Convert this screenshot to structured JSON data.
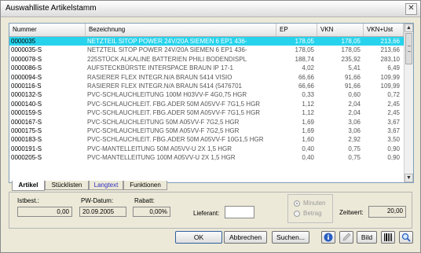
{
  "window": {
    "title": "Auswahlliste Artikelstamm"
  },
  "columns": [
    "Nummer",
    "Bezeichnung",
    "EP",
    "VKN",
    "VKN+Ust"
  ],
  "rows": [
    {
      "nr": "0000035",
      "bez": "NETZTEIL SITOP POWER 24V/20A     SIEMEN 6 EP1 436-",
      "ep": "178,05",
      "vkn": "178,05",
      "vku": "213,66",
      "selected": true
    },
    {
      "nr": "0000035-S",
      "bez": "NETZTEIL SITOP POWER 24V/20A     SIEMEN 6 EP1 436-",
      "ep": "178,05",
      "vkn": "178,05",
      "vku": "213,66"
    },
    {
      "nr": "0000078-S",
      "bez": "225STÜCK ALKALINE BATTERIEN      PHILI BODENDISPL",
      "ep": "188,74",
      "vkn": "235,92",
      "vku": "283,10"
    },
    {
      "nr": "0000086-S",
      "bez": "AUFSTECKBÜRSTE INTERSPACE        BRAUN IP   17-1",
      "ep": "4,02",
      "vkn": "5,41",
      "vku": "6,49"
    },
    {
      "nr": "0000094-S",
      "bez": "RASIERER FLEX INTEGR.N/A           BRAUN 5414    VISIO",
      "ep": "66,66",
      "vkn": "91,66",
      "vku": "109,99"
    },
    {
      "nr": "0000116-S",
      "bez": "RASIERER FLEX INTEGR.N/A           BRAUN 5414 (5476701",
      "ep": "66,66",
      "vkn": "91,66",
      "vku": "109,99"
    },
    {
      "nr": "0000132-S",
      "bez": "PVC-SCHLAUCHLEITUNG          100M H03VV-F 4G0,75 HGR",
      "ep": "0,33",
      "vkn": "0,60",
      "vku": "0,72"
    },
    {
      "nr": "0000140-S",
      "bez": "PVC-SCHLAUCHLEIT. FBG.ADER 50M A05VV-F 7G1,5  HGR",
      "ep": "1,12",
      "vkn": "2,04",
      "vku": "2,45"
    },
    {
      "nr": "0000159-S",
      "bez": "PVC-SCHLAUCHLEIT. FBG.ADER 50M A05VV-F 7G1,5  HGR",
      "ep": "1,12",
      "vkn": "2,04",
      "vku": "2,45"
    },
    {
      "nr": "0000167-S",
      "bez": "PVC-SCHLAUCHLEITUNG           50M  A05VV-F 7G2,5  HGR",
      "ep": "1,69",
      "vkn": "3,06",
      "vku": "3,67"
    },
    {
      "nr": "0000175-S",
      "bez": "PVC-SCHLAUCHLEITUNG           50M  A05VV-F 7G2,5  HGR",
      "ep": "1,69",
      "vkn": "3,06",
      "vku": "3,67"
    },
    {
      "nr": "0000183-S",
      "bez": "PVC-SCHLAUCHLEIT. FBG.ADER 50M A05VV-F 10G1,5 HGR",
      "ep": "1,60",
      "vkn": "2,92",
      "vku": "3,50"
    },
    {
      "nr": "0000191-S",
      "bez": "PVC-MANTELLEITUNG              50M  A05VV-U   2X  1,5 HGR",
      "ep": "0,40",
      "vkn": "0,75",
      "vku": "0,90"
    },
    {
      "nr": "0000205-S",
      "bez": "PVC-MANTELLEITUNG              100M A05VV-U   2X  1,5 HGR",
      "ep": "0,40",
      "vkn": "0,75",
      "vku": "0,90"
    }
  ],
  "tabs": [
    "Artikel",
    "Stücklisten",
    "Langtext",
    "Funktionen"
  ],
  "details": {
    "istbest_label": "Istbest.:",
    "istbest_value": "0,00",
    "pwdatum_label": "PW-Datum:",
    "pwdatum_value": "20.09.2005",
    "rabatt_label": "Rabatt:",
    "rabatt_value": "0,00%",
    "lieferant_label": "Lieferant:",
    "lieferant_value": "",
    "radio_minuten": "Minuten",
    "radio_betrag": "Betrag",
    "zeitwert_label": "Zeitwert:",
    "zeitwert_value": "20,00"
  },
  "buttons": {
    "ok": "OK",
    "abbrechen": "Abbrechen",
    "suchen": "Suchen...",
    "bild": "Bild"
  }
}
